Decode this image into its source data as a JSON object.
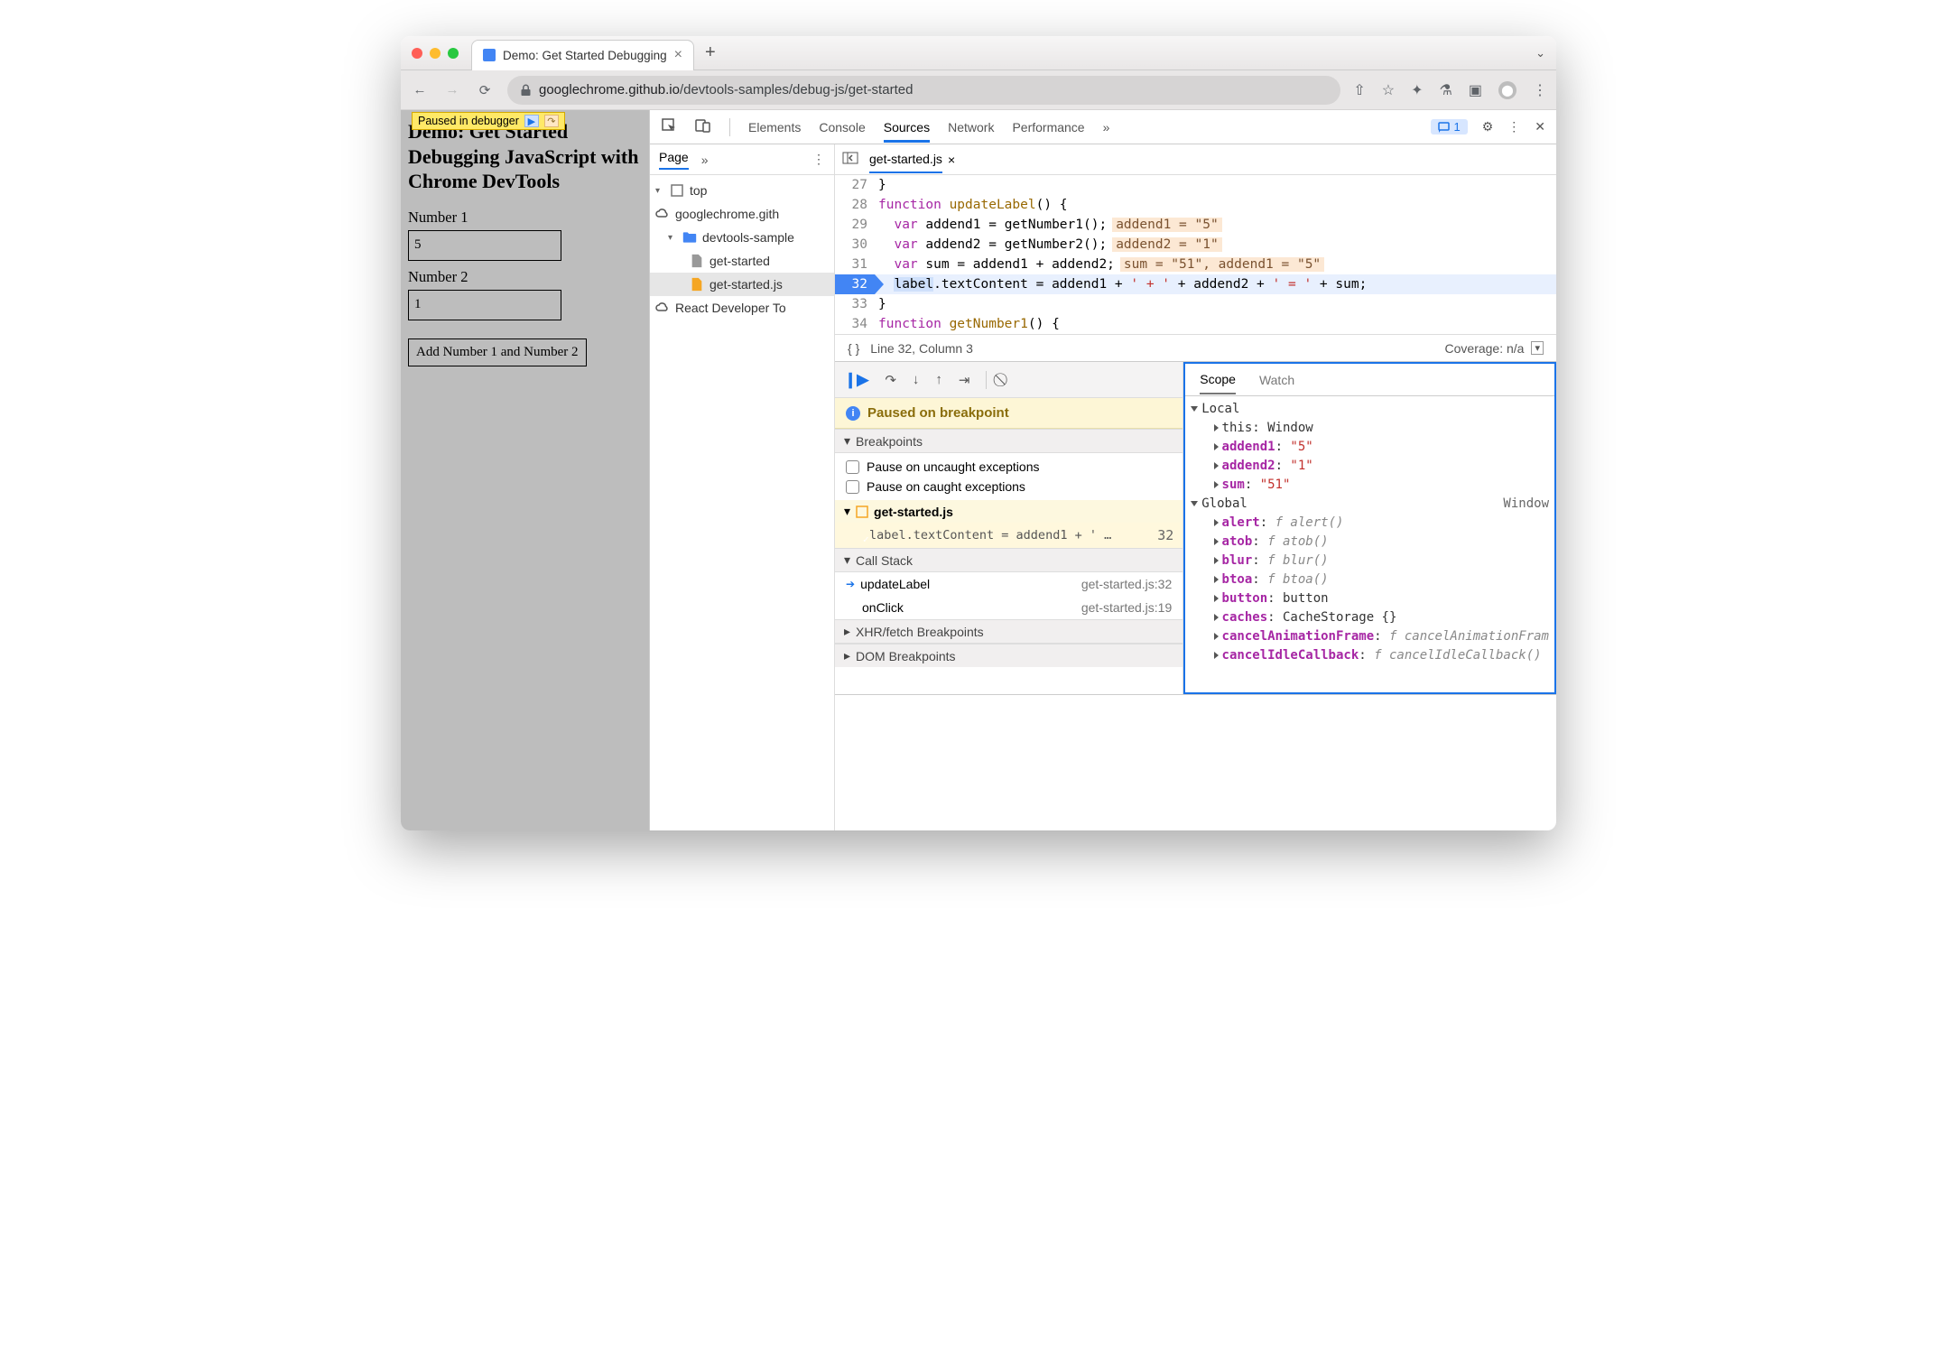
{
  "browser": {
    "tab_title": "Demo: Get Started Debugging",
    "url_host": "googlechrome.github.io",
    "url_path": "/devtools-samples/debug-js/get-started"
  },
  "page": {
    "overlay": "Paused in debugger",
    "heading": "Demo: Get Started Debugging JavaScript with Chrome DevTools",
    "label1": "Number 1",
    "value1": "5",
    "label2": "Number 2",
    "value2": "1",
    "button": "Add Number 1 and Number 2"
  },
  "devtools": {
    "tabs": [
      "Elements",
      "Console",
      "Sources",
      "Network",
      "Performance"
    ],
    "active": "Sources",
    "issues": "1",
    "nav": {
      "page": "Page",
      "tree": {
        "top": "top",
        "domain": "googlechrome.gith",
        "folder": "devtools-sample",
        "html": "get-started",
        "js": "get-started.js",
        "ext": "React Developer To"
      }
    },
    "editor": {
      "file": "get-started.js",
      "status": "Line 32, Column 3",
      "coverage": "Coverage: n/a",
      "lines": [
        {
          "n": 27,
          "html": "}"
        },
        {
          "n": 28,
          "html": "<span class='c-kw'>function</span> <span class='c-fn'>updateLabel</span>() {"
        },
        {
          "n": 29,
          "html": "  <span class='c-kw'>var</span> addend1 = getNumber1();",
          "hint": "addend1 = \"5\""
        },
        {
          "n": 30,
          "html": "  <span class='c-kw'>var</span> addend2 = getNumber2();",
          "hint": "addend2 = \"1\""
        },
        {
          "n": 31,
          "html": "  <span class='c-kw'>var</span> sum = addend1 + addend2;",
          "hint": "sum = \"51\", addend1 = \"5\""
        },
        {
          "n": 32,
          "exec": true,
          "html": "  <span class='c-lab'>label</span>.textContent = addend1 + <span class='c-str'>' + '</span> + addend2 + <span class='c-str'>' = '</span> + sum;"
        },
        {
          "n": 33,
          "html": "}"
        },
        {
          "n": 34,
          "html": "<span class='c-kw'>function</span> <span class='c-fn'>getNumber1</span>() {"
        }
      ]
    },
    "pause_msg": "Paused on breakpoint",
    "sections": {
      "breakpoints": "Breakpoints",
      "uncaught": "Pause on uncaught exceptions",
      "caught": "Pause on caught exceptions",
      "bp_file": "get-started.js",
      "bp_item": "label.textContent = addend1 + ' …",
      "bp_line": "32",
      "callstack": "Call Stack",
      "cs": [
        {
          "fn": "updateLabel",
          "loc": "get-started.js:32",
          "cur": true
        },
        {
          "fn": "onClick",
          "loc": "get-started.js:19"
        }
      ],
      "xhr": "XHR/fetch Breakpoints",
      "dom": "DOM Breakpoints"
    },
    "scope": {
      "tab1": "Scope",
      "tab2": "Watch",
      "local": "Local",
      "vars": [
        {
          "k": "this",
          "v": "Window",
          "cls": "t"
        },
        {
          "k": "addend1",
          "v": "\"5\"",
          "cls": "s",
          "bold": true
        },
        {
          "k": "addend2",
          "v": "\"1\"",
          "cls": "s",
          "bold": true
        },
        {
          "k": "sum",
          "v": "\"51\"",
          "cls": "s",
          "bold": true
        }
      ],
      "global": "Global",
      "global_v": "Window",
      "globals": [
        {
          "k": "alert",
          "v": "f alert()"
        },
        {
          "k": "atob",
          "v": "f atob()"
        },
        {
          "k": "blur",
          "v": "f blur()"
        },
        {
          "k": "btoa",
          "v": "f btoa()"
        },
        {
          "k": "button",
          "v": "button",
          "plain": true
        },
        {
          "k": "caches",
          "v": "CacheStorage {}",
          "plain": true
        },
        {
          "k": "cancelAnimationFrame",
          "v": "f cancelAnimationFram"
        },
        {
          "k": "cancelIdleCallback",
          "v": "f cancelIdleCallback()"
        }
      ]
    }
  }
}
